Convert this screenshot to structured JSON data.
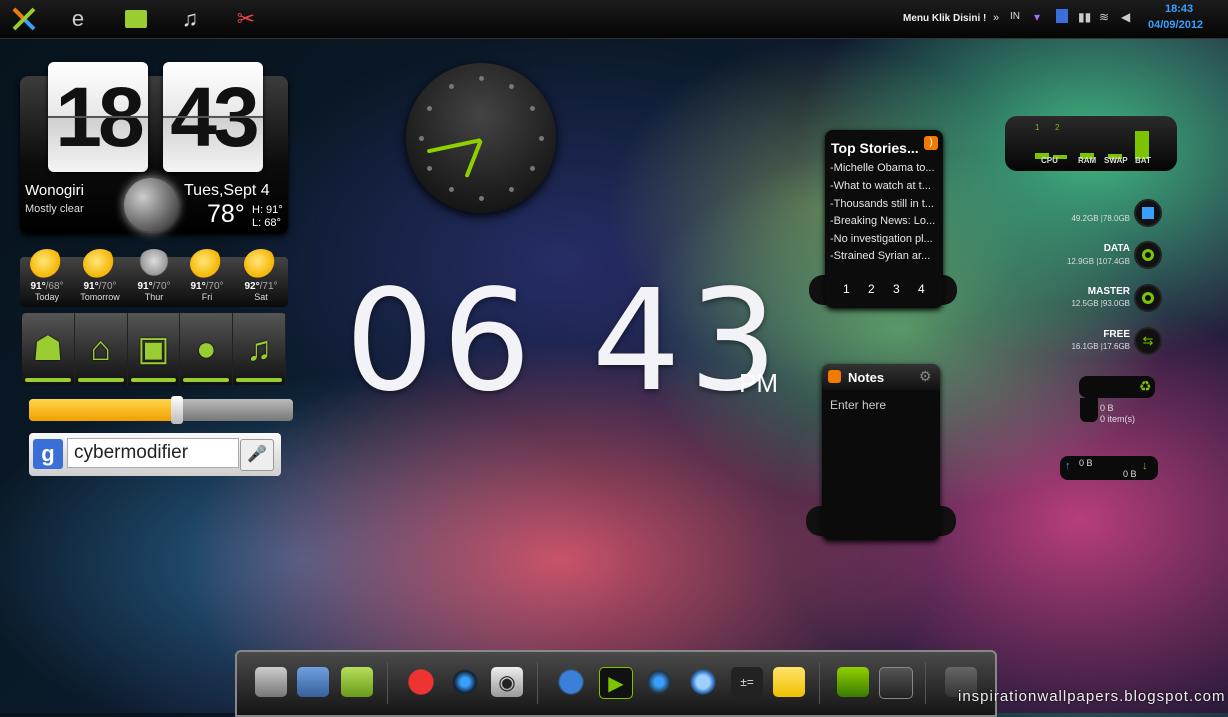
{
  "taskbar": {
    "menu_label": "Menu Klik Disini !",
    "overflow": "»",
    "language": "IN",
    "time": "18:43",
    "date": "04/09/2012"
  },
  "weather_widget": {
    "hour": "18",
    "minute": "43",
    "city": "Wonogiri",
    "condition": "Mostly clear",
    "day": "Tues,Sept 4",
    "temperature": "78°",
    "high": "H: 91°",
    "low": "L: 68°"
  },
  "forecast": [
    {
      "temp": "91°",
      "low": "/68°",
      "day": "Today",
      "icon": "sun-cloud-icon"
    },
    {
      "temp": "91°",
      "low": "/70°",
      "day": "Tomorrow",
      "icon": "sun-icon"
    },
    {
      "temp": "91°",
      "low": "/70°",
      "day": "Thur",
      "icon": "storm-cloud-icon"
    },
    {
      "temp": "91°",
      "low": "/70°",
      "day": "Fri",
      "icon": "sun-cloud-icon"
    },
    {
      "temp": "92°",
      "low": "/71°",
      "day": "Sat",
      "icon": "sun-cloud-icon"
    }
  ],
  "app_bar": [
    "android-icon",
    "home-icon",
    "trash-icon",
    "globe-icon",
    "music-icon"
  ],
  "volume_slider": {
    "level": 0.56
  },
  "google_search": {
    "logo": "g",
    "query": "cybermodifier"
  },
  "analog_clock": {
    "hour": 18,
    "minute": 43
  },
  "digital_clock": {
    "time": "06 43",
    "ampm": "PM"
  },
  "top_stories": {
    "title": "Top Stories...",
    "items": [
      "-Michelle Obama to...",
      "-What to watch at t...",
      "-Thousands still in t...",
      "-Breaking News: Lo...",
      "-No investigation pl...",
      "-Strained Syrian ar..."
    ],
    "pages": [
      "1",
      "2",
      "3",
      "4"
    ]
  },
  "notes": {
    "title": "Notes",
    "placeholder": "Enter here"
  },
  "system_meter": {
    "cpu_cores": [
      "1",
      "2"
    ],
    "labels": [
      "CPU",
      "RAM",
      "SWAP",
      "BAT"
    ]
  },
  "drives": [
    {
      "name": "",
      "size": "49.2GB |78.0GB"
    },
    {
      "name": "DATA",
      "size": "12.9GB |107.4GB"
    },
    {
      "name": "MASTER",
      "size": "12.5GB |93.0GB"
    },
    {
      "name": "FREE",
      "size": "16.1GB |17.6GB"
    }
  ],
  "recycle_bin": {
    "size": "0 B",
    "items": "0 item(s)"
  },
  "network": {
    "up": "0 B",
    "down": "0 B"
  },
  "dock": [
    "drive-icon",
    "network-icon",
    "folder-icon",
    "angry-birds-icon",
    "media-icon",
    "camera-icon",
    "globe-icon",
    "video-icon",
    "speaker-icon",
    "orb-icon",
    "calculator-icon",
    "sticky-note-icon",
    "jelly-bean-icon",
    "gallery-icon",
    "trash-icon"
  ],
  "watermark": "inspirationwallpapers.blogspot.com"
}
